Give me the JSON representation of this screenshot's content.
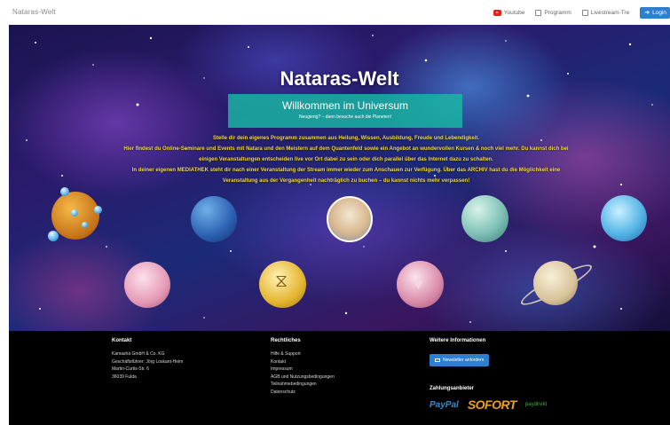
{
  "topbar": {
    "brand": "Nataras-Welt",
    "nav": {
      "youtube": "Youtube",
      "program": "Programm",
      "livestream": "Livestream-Tre",
      "login": "Login"
    }
  },
  "hero": {
    "title": "Nataras-Welt",
    "welcome_title": "Willkommen im Universum",
    "welcome_sub": "Neugierig? – dann besuche auch die Planeten!",
    "lines": [
      "Stelle dir dein eigenes Programm zusammen aus Heilung, Wissen, Ausbildung, Freude und Lebendigkeit.",
      "Hier findest du Online-Seminare und Events mit Natara und den Meistern auf dem Quantenfeld sowie ein Angebot an wundervollen Kursen & noch viel mehr. Du kannst dich bei",
      "einigen Veranstaltungen entscheiden live vor Ort dabei zu sein oder dich parallel über das Internet dazu zu schalten.",
      "In deiner eigenen MEDIATHEK steht dir nach einer Veranstaltung der Stream immer wieder zum Anschauen zur Verfügung. Über das ARCHIV hast du die Möglichkeit eine",
      "Veranstaltung aus der Vergangenheit nachträglich zu buchen – du kannst nichts mehr verpassen!"
    ]
  },
  "footer": {
    "contact": {
      "heading": "Kontakt",
      "lines": [
        "Kamasha GmbH & Co. KG",
        "Geschäftsführer: Jörg Loskant-Heim",
        "Martin-Curtis-Str. 6",
        "36039 Fulda"
      ]
    },
    "legal": {
      "heading": "Rechtliches",
      "links": [
        "Hilfe & Support",
        "Kontakt",
        "Impressum",
        "AGB und Nutzungsbedingungen",
        "Teilnahmebedingungen",
        "Datenschutz"
      ]
    },
    "info": {
      "heading": "Weitere Informationen",
      "newsletter_button": "Newsletter anfordern",
      "payment_heading": "Zahlungsanbieter",
      "payment_providers": [
        "PayPal",
        "SOFORT",
        "paydirekt"
      ]
    }
  },
  "colors": {
    "accent_blue": "#2f7fd0",
    "welcome_teal": "#19b9a5",
    "hero_text_yellow": "#f3d44a",
    "youtube_red": "#e0241b"
  }
}
